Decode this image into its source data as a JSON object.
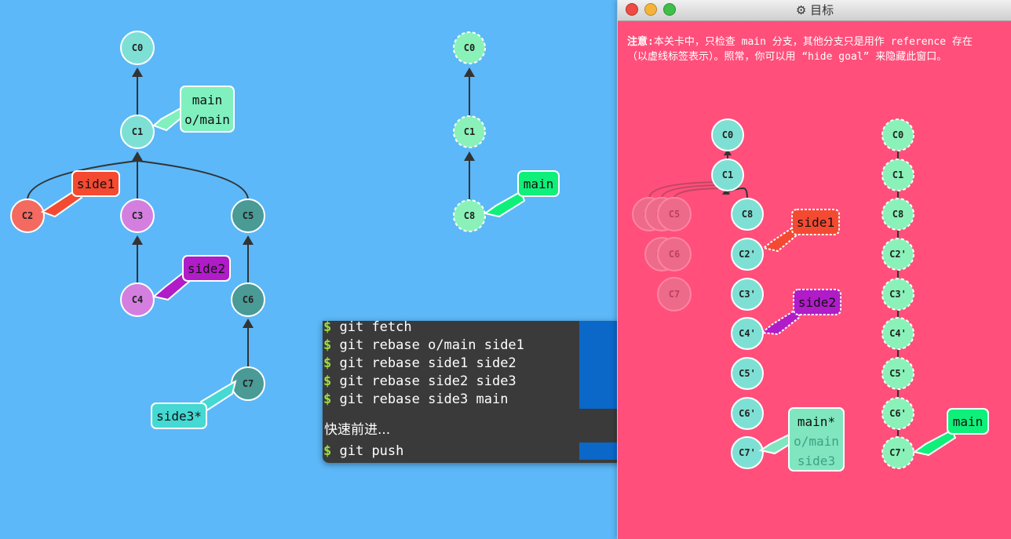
{
  "colors": {
    "background": "#5cb8f8",
    "goal_background": "#ff4f7a",
    "node_default": "#7ee0d4",
    "node_red": "#f46a60",
    "node_purple": "#d47fe0",
    "node_teal_dark": "#4a9a96",
    "node_green": "#8af2b8",
    "branch_main": "#80f0bf",
    "branch_side1": "#f44a32",
    "branch_side2": "#b01cc8",
    "branch_side3": "#46d8d2",
    "terminal_bg": "#3a3a3a",
    "terminal_check_bg": "#0b67c8"
  },
  "main_graph": {
    "nodes": [
      "C0",
      "C1",
      "C2",
      "C3",
      "C5",
      "C4",
      "C6",
      "C7"
    ],
    "branches": {
      "main": [
        "main",
        "o/main"
      ],
      "side1": "side1",
      "side2": "side2",
      "side3": "side3*"
    }
  },
  "remote_graph": {
    "nodes": [
      "C0",
      "C1",
      "C8"
    ],
    "branch": "main"
  },
  "terminal": {
    "commands": [
      "git fetch",
      "git rebase o/main side1",
      "git rebase side1 side2",
      "git rebase side2 side3",
      "git rebase side3 main"
    ],
    "fast_forward": "快速前进...",
    "push": "git push",
    "prompt": "$",
    "close_icon": "close-icon"
  },
  "goal_window": {
    "title": "目标",
    "title_icon": "gear-icon",
    "note_bold": "注意:",
    "note_text": "本关卡中，只检查 main 分支，其他分支只是用作 reference 存在（以虚线标签表示）。照常，你可以用 “hide goal” 来隐藏此窗口。",
    "local_nodes": [
      "C0",
      "C1",
      "C8",
      "C2'",
      "C3'",
      "C4'",
      "C5'",
      "C6'",
      "C7'"
    ],
    "ghost_nodes": [
      "C2",
      "C3",
      "C5",
      "C4",
      "C6",
      "C7"
    ],
    "local_branches": {
      "side1": "side1",
      "side2": "side2",
      "main": [
        "main*",
        "o/main",
        "side3"
      ]
    },
    "remote_nodes": [
      "C0",
      "C1",
      "C8",
      "C2'",
      "C3'",
      "C4'",
      "C5'",
      "C6'",
      "C7'"
    ],
    "remote_branch": "main"
  }
}
